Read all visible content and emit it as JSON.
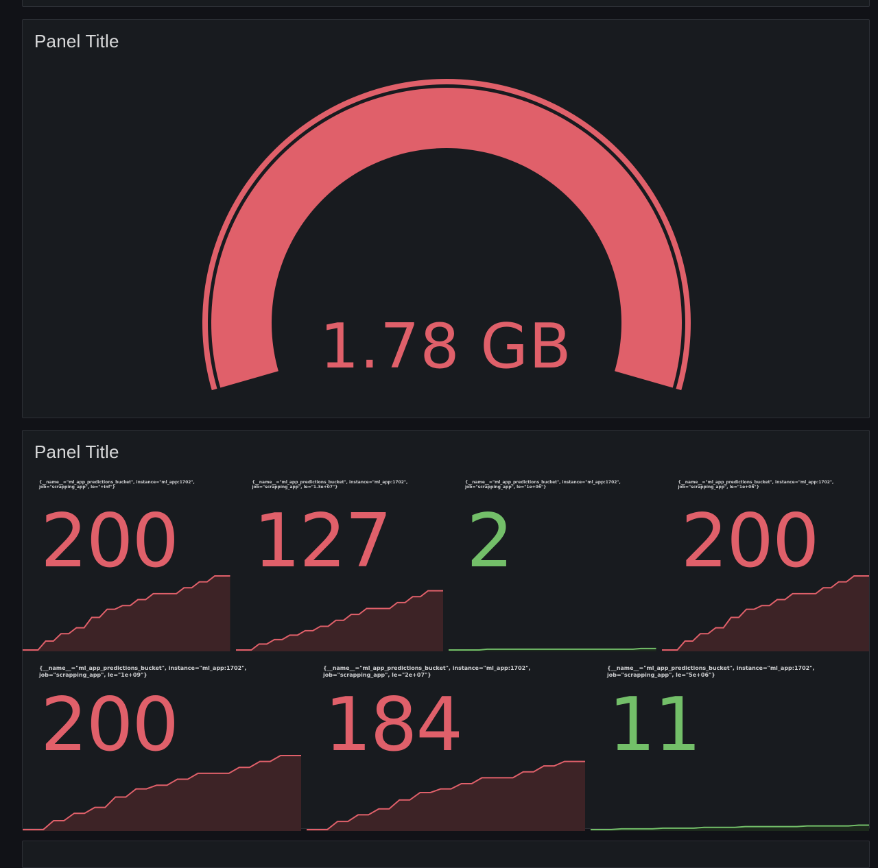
{
  "colors": {
    "background": "#111217",
    "panel": "#181b1f",
    "red": "#e0606a",
    "red_fill": "#3d2326",
    "green": "#73bf69",
    "green_fill": "#1d2a1d"
  },
  "gauge_panel": {
    "title": "Panel Title",
    "value": "1.78 GB",
    "fill_fraction": 1.0
  },
  "stat_panel": {
    "title": "Panel Title",
    "row1": [
      {
        "label": "{__name__=\"ml_app_predictions_bucket\", instance=\"ml_app:1702\", job=\"scrapping_app\", le=\"+Inf\"}",
        "value": "200",
        "color": "red",
        "spark": [
          0,
          0,
          0,
          12,
          12,
          22,
          22,
          30,
          30,
          44,
          44,
          55,
          55,
          60,
          60,
          68,
          68,
          76,
          76,
          76,
          76,
          84,
          84,
          92,
          92,
          100,
          100,
          100
        ]
      },
      {
        "label": "{__name__=\"ml_app_predictions_bucket\", instance=\"ml_app:1702\", job=\"scrapping_app\", le=\"1.3e+07\"}",
        "value": "127",
        "color": "red",
        "spark": [
          0,
          0,
          0,
          8,
          8,
          14,
          14,
          20,
          20,
          26,
          26,
          32,
          32,
          40,
          40,
          48,
          48,
          56,
          56,
          56,
          56,
          64,
          64,
          72,
          72,
          80,
          80,
          80
        ]
      },
      {
        "label": "{__name__=\"ml_app_predictions_bucket\", instance=\"ml_app:1702\", job=\"scrapping_app\", le=\"1e+06\"}",
        "value": "2",
        "color": "green",
        "spark": [
          0,
          0,
          0,
          0,
          0,
          1,
          1,
          1,
          1,
          1,
          1,
          1,
          1,
          1,
          1,
          1,
          1,
          1,
          1,
          1,
          1,
          1,
          1,
          1,
          1,
          2,
          2,
          2
        ]
      },
      {
        "label": "{__name__=\"ml_app_predictions_bucket\", instance=\"ml_app:1702\", job=\"scrapping_app\", le=\"1e+06\"}",
        "value": "200",
        "color": "red",
        "spark": [
          0,
          0,
          0,
          12,
          12,
          22,
          22,
          30,
          30,
          44,
          44,
          55,
          55,
          60,
          60,
          68,
          68,
          76,
          76,
          76,
          76,
          84,
          84,
          92,
          92,
          100,
          100,
          100
        ]
      }
    ],
    "row2": [
      {
        "label": "{__name__=\"ml_app_predictions_bucket\", instance=\"ml_app:1702\", job=\"scrapping_app\", le=\"1e+09\"}",
        "value": "200",
        "color": "red",
        "spark": [
          0,
          0,
          0,
          12,
          12,
          22,
          22,
          30,
          30,
          44,
          44,
          55,
          55,
          60,
          60,
          68,
          68,
          76,
          76,
          76,
          76,
          84,
          84,
          92,
          92,
          100,
          100,
          100
        ]
      },
      {
        "label": "{__name__=\"ml_app_predictions_bucket\", instance=\"ml_app:1702\", job=\"scrapping_app\", le=\"2e+07\"}",
        "value": "184",
        "color": "red",
        "spark": [
          0,
          0,
          0,
          11,
          11,
          20,
          20,
          28,
          28,
          40,
          40,
          50,
          50,
          55,
          55,
          62,
          62,
          70,
          70,
          70,
          70,
          78,
          78,
          86,
          86,
          92,
          92,
          92
        ]
      },
      {
        "label": "{__name__=\"ml_app_predictions_bucket\", instance=\"ml_app:1702\", job=\"scrapping_app\", le=\"5e+06\"}",
        "value": "11",
        "color": "green",
        "spark": [
          0,
          0,
          0,
          1,
          1,
          1,
          1,
          2,
          2,
          2,
          2,
          3,
          3,
          3,
          3,
          4,
          4,
          4,
          4,
          4,
          4,
          5,
          5,
          5,
          5,
          5,
          6,
          6
        ]
      }
    ]
  }
}
